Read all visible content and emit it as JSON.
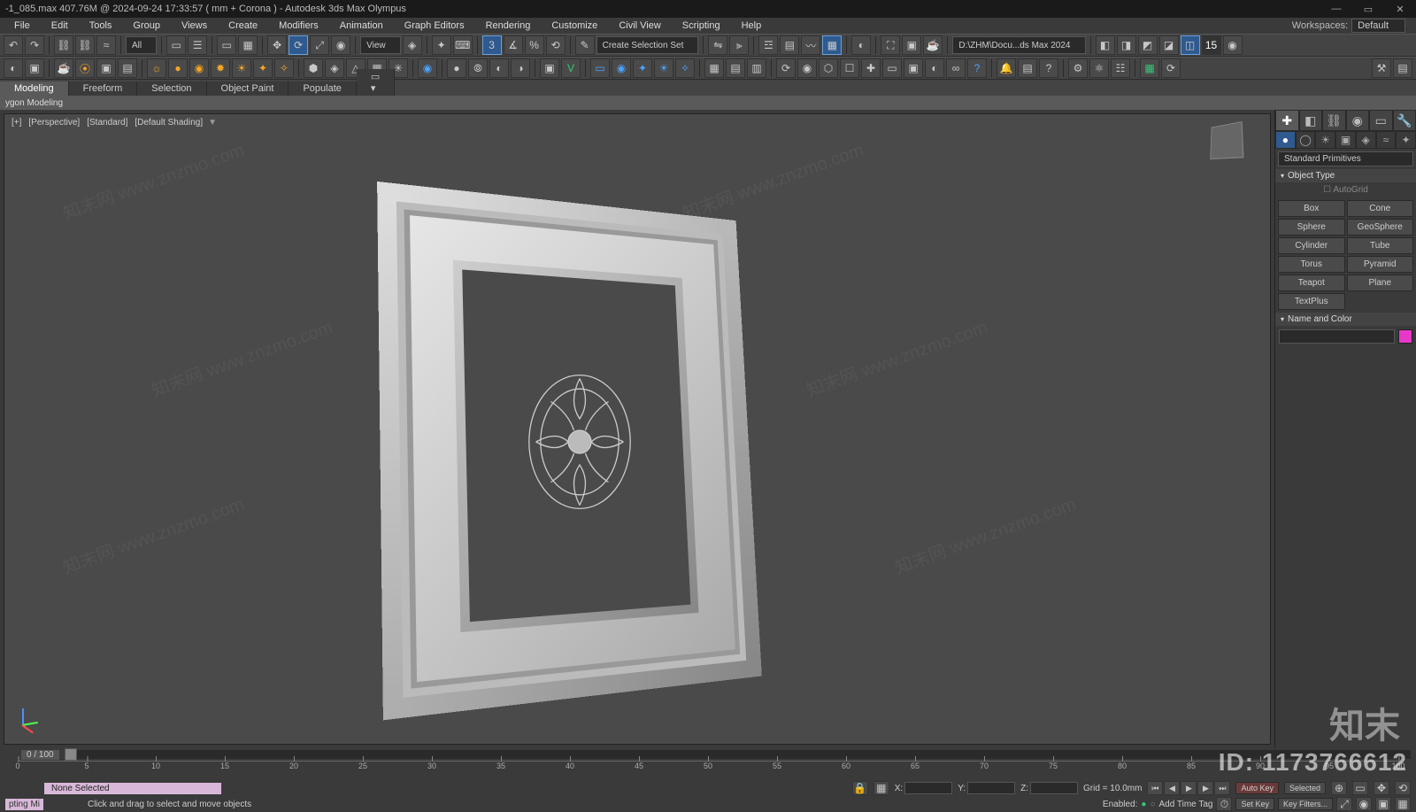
{
  "title": "-1_085.max  407.76M @ 2024-09-24 17:33:57  ( mm + Corona ) - Autodesk 3ds Max Olympus",
  "menus": [
    "File",
    "Edit",
    "Tools",
    "Group",
    "Views",
    "Create",
    "Modifiers",
    "Animation",
    "Graph Editors",
    "Rendering",
    "Customize",
    "Civil View",
    "Scripting",
    "Help"
  ],
  "workspaces_label": "Workspaces:",
  "workspaces_value": "Default",
  "toolbar1": {
    "all_dd": "All",
    "view_dd": "View",
    "named_sel": "Create Selection Set",
    "project_path": "D:\\ZHM\\Docu...ds Max 2024"
  },
  "ribbon_tabs": [
    "Modeling",
    "Freeform",
    "Selection",
    "Object Paint",
    "Populate"
  ],
  "subribbon": "ygon Modeling",
  "viewport_label_parts": [
    "[+]",
    "[Perspective]",
    "[Standard]",
    "[Default Shading]"
  ],
  "cmdpanel": {
    "category_dd": "Standard Primitives",
    "rollout_obj": "Object Type",
    "autogrid": "AutoGrid",
    "prims": [
      "Box",
      "Cone",
      "Sphere",
      "GeoSphere",
      "Cylinder",
      "Tube",
      "Torus",
      "Pyramid",
      "Teapot",
      "Plane",
      "TextPlus"
    ],
    "rollout_name": "Name and Color"
  },
  "timeslider": {
    "label": "0 / 100"
  },
  "ruler_ticks": [
    "0",
    "5",
    "10",
    "15",
    "20",
    "25",
    "30",
    "35",
    "40",
    "45",
    "50",
    "55",
    "60",
    "65",
    "70",
    "75",
    "80",
    "85",
    "90",
    "95",
    "100"
  ],
  "status": {
    "selection": "None Selected",
    "prompt": "Click and drag to select and move objects",
    "script_mini": "pting Mi",
    "x_label": "X:",
    "y_label": "Y:",
    "z_label": "Z:",
    "grid": "Grid = 10.0mm",
    "enabled": "Enabled:",
    "addtag": "Add Time Tag",
    "setkey": "Set Key",
    "keyfilters": "Key Filters...",
    "selected_only": "Selected",
    "autokey": "Auto Key",
    "frame_badge": "15"
  },
  "overlay": {
    "id_label": "ID: 1173766612",
    "logo": "知末"
  },
  "watermark": "知末网 www.znzmo.com"
}
